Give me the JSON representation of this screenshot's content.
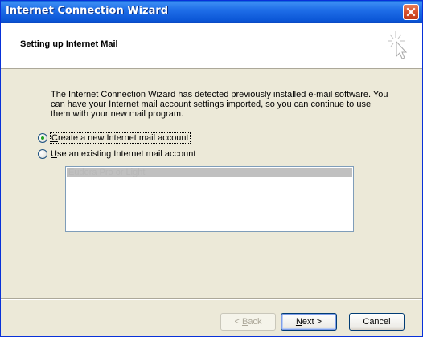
{
  "window": {
    "title": "Internet Connection Wizard"
  },
  "header": {
    "title": "Setting up Internet Mail"
  },
  "body": {
    "intro_text": "The Internet Connection Wizard has detected previously installed e-mail software. You can have your Internet mail account settings imported, so you can continue to use them with your new mail program.",
    "options": [
      {
        "mnemonic": "C",
        "rest": "reate a new Internet mail account",
        "selected": true
      },
      {
        "mnemonic": "U",
        "rest": "se an existing Internet mail account",
        "selected": false
      }
    ],
    "existing_accounts": [
      "Eudora Pro or Light"
    ]
  },
  "buttons": {
    "back_prefix": "< ",
    "back_mnemonic": "B",
    "back_rest": "ack",
    "next_mnemonic": "N",
    "next_rest": "ext >",
    "cancel": "Cancel"
  },
  "colors": {
    "title_bar": "#0b56d6",
    "dialog_bg": "#ece9d8",
    "radio_dot": "#21a121"
  }
}
